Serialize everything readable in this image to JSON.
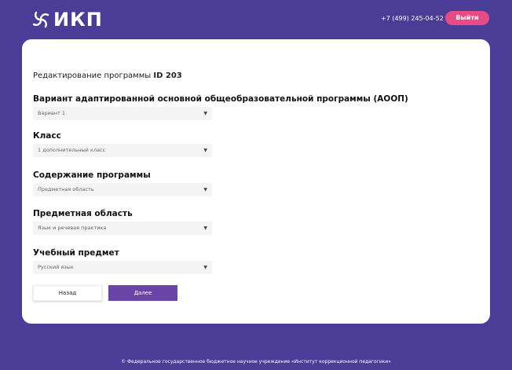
{
  "header": {
    "logo_text": "ИКП",
    "phone": "+7 (499) 245-04-52",
    "logout_label": "Выйти"
  },
  "form": {
    "title_prefix": "Редактирование программы",
    "title_id": "ID 203",
    "fields": [
      {
        "label": "Вариант адаптированной основной общеобразовательной программы (АООП)",
        "value": "Вариант 1"
      },
      {
        "label": "Класс",
        "value": "1 дополнительный класс"
      },
      {
        "label": "Содержание программы",
        "value": "Предметная область"
      },
      {
        "label": "Предметная область",
        "value": "Язык и речевая практика"
      },
      {
        "label": "Учебный предмет",
        "value": "Русский язык"
      }
    ],
    "back_label": "Назад",
    "next_label": "Далее"
  },
  "footer": {
    "text": "© Федеральное государственное бюджетное научное учреждение «Институт коррекционной педагогики»"
  },
  "colors": {
    "background": "#4b3c98",
    "logout": "#e84a86",
    "primary_button": "#6a45a8"
  },
  "icons": {
    "logo": "swirl-logo-icon",
    "select_arrow": "dropdown-arrow-icon"
  }
}
